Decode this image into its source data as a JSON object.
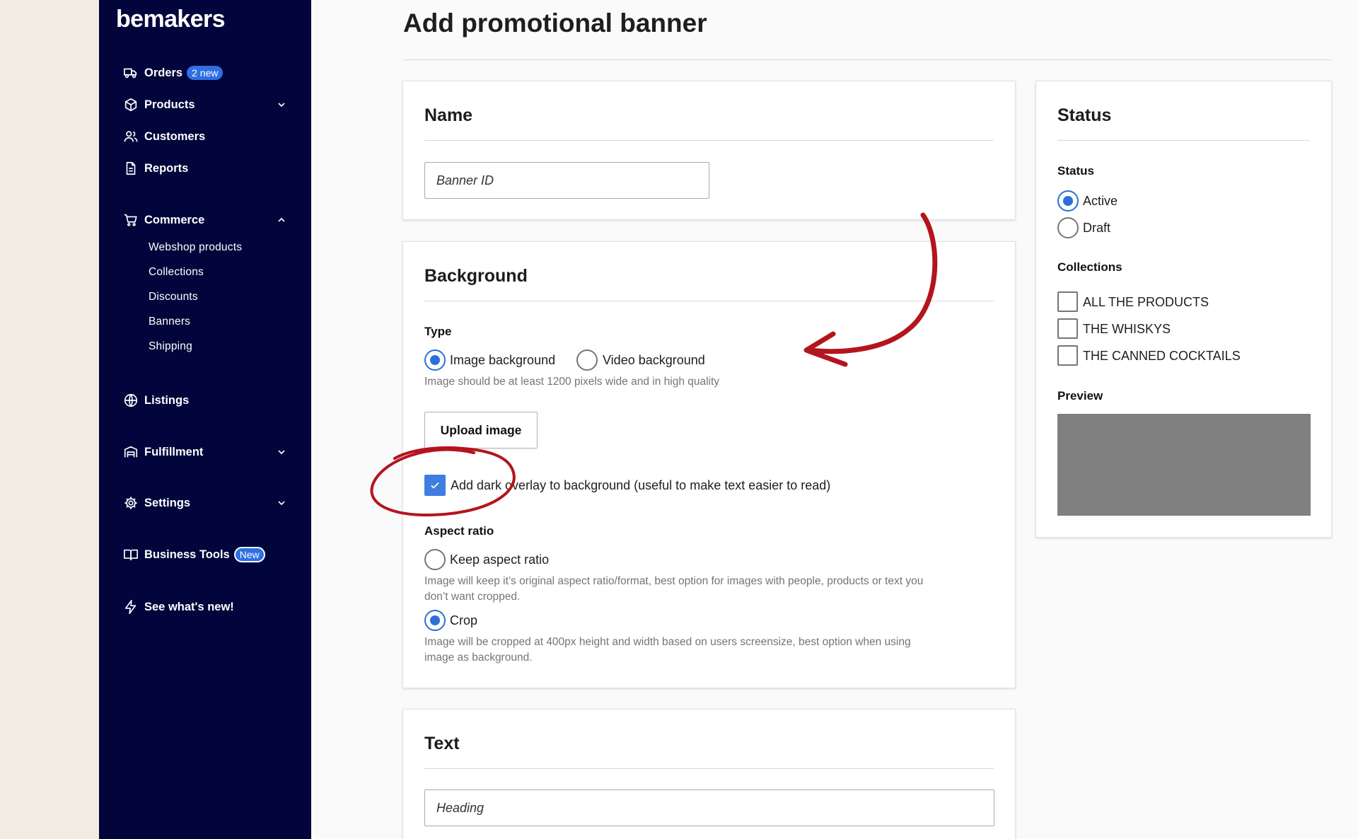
{
  "brand": {
    "name": "bemakers"
  },
  "sidebar": {
    "items": [
      {
        "label": "Orders",
        "badge": "2 new",
        "icon": "truck-icon"
      },
      {
        "label": "Products",
        "icon": "box-icon",
        "chevron": "down"
      },
      {
        "label": "Customers",
        "icon": "users-icon"
      },
      {
        "label": "Reports",
        "icon": "document-icon"
      },
      {
        "label": "Commerce",
        "icon": "cart-icon",
        "chevron": "up",
        "subitems": [
          "Webshop products",
          "Collections",
          "Discounts",
          "Banners",
          "Shipping"
        ]
      },
      {
        "label": "Listings",
        "icon": "globe-icon"
      },
      {
        "label": "Fulfillment",
        "icon": "warehouse-icon",
        "chevron": "down"
      },
      {
        "label": "Settings",
        "icon": "gear-icon",
        "chevron": "down"
      },
      {
        "label": "Business Tools",
        "badge": "New",
        "icon": "book-icon"
      },
      {
        "label": "See what's new!",
        "icon": "lightning-icon"
      }
    ]
  },
  "page": {
    "title": "Add promotional banner"
  },
  "name_card": {
    "title": "Name",
    "input_placeholder": "Banner ID"
  },
  "background_card": {
    "title": "Background",
    "type_label": "Type",
    "type_options": [
      "Image background",
      "Video background"
    ],
    "type_selected": "Image background",
    "type_hint": "Image should be at least 1200 pixels wide and in high quality",
    "upload_button": "Upload image",
    "overlay_checkbox_label": "Add dark overlay to background (useful to make text easier to read)",
    "overlay_checked": true,
    "aspect_label": "Aspect ratio",
    "aspect_options": [
      {
        "label": "Keep aspect ratio",
        "hint_1": "Image will keep it’s original aspect ratio/format, best option for images with people, products or text you",
        "hint_2": "don’t want cropped."
      },
      {
        "label": "Crop",
        "hint_1": "Image will be cropped at 400px height and width based on users screensize, best option when using",
        "hint_2": "image as background."
      }
    ],
    "aspect_selected": "Crop"
  },
  "text_card": {
    "title": "Text",
    "heading_placeholder": "Heading"
  },
  "status_card": {
    "title": "Status",
    "status_label": "Status",
    "status_options": [
      "Active",
      "Draft"
    ],
    "status_selected": "Active",
    "collections_label": "Collections",
    "collections": [
      "ALL THE PRODUCTS",
      "THE WHISKYS",
      "THE CANNED COCKTAILS"
    ],
    "preview_label": "Preview"
  },
  "colors": {
    "sidebar_bg": "#01053b",
    "accent": "#2c6fd8",
    "annotation_red": "#b3151d",
    "preview_gray": "#808080"
  }
}
